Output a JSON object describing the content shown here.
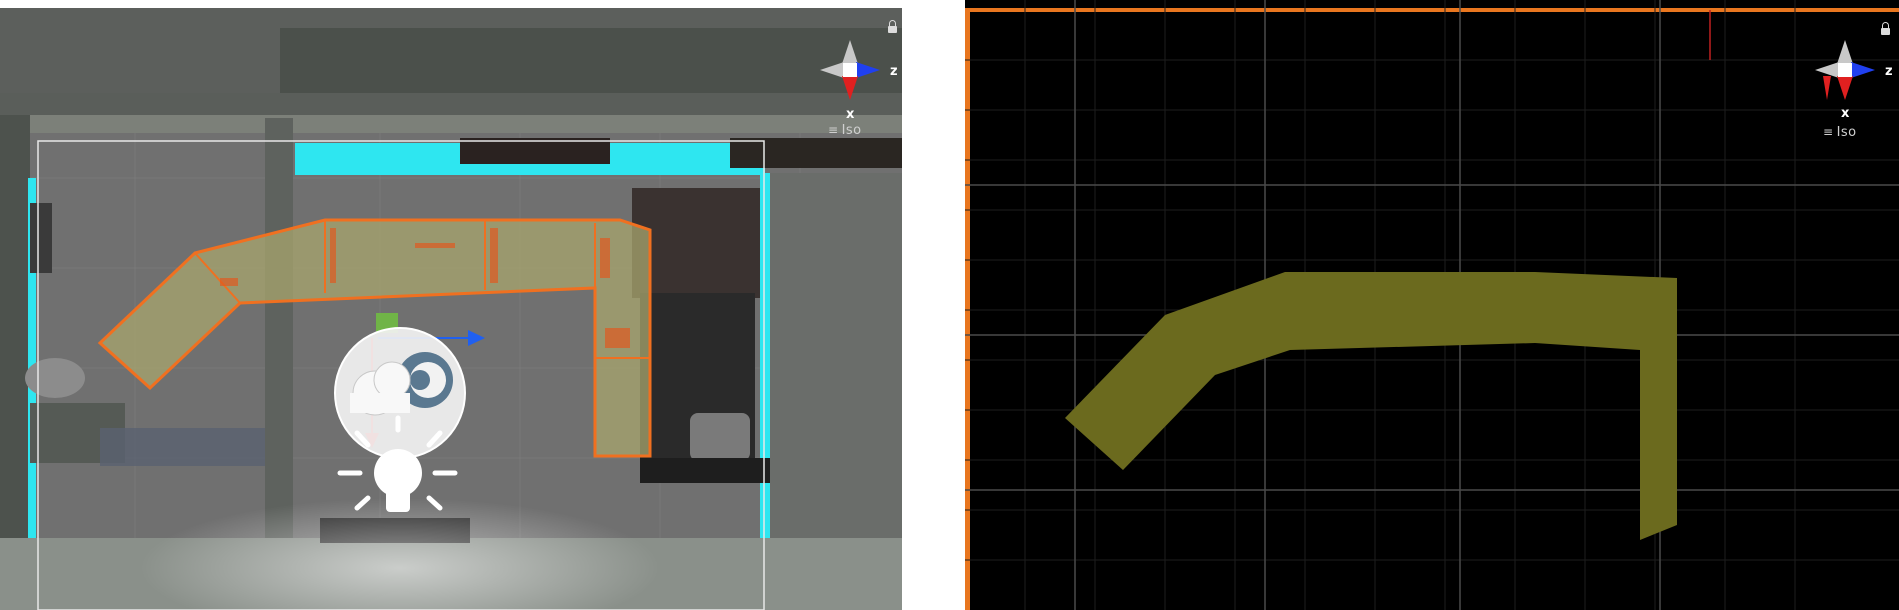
{
  "left_view": {
    "gizmo": {
      "x_label": "x",
      "z_label": "z",
      "projection": "Iso"
    },
    "colors": {
      "selection_outline": "#f07020",
      "cyan_edge": "#2ee6f0",
      "gizmo_x": "#e02020",
      "gizmo_z": "#2040f0"
    },
    "icons": [
      "scene-gizmo-icon",
      "lock-icon",
      "reflection-probe-icon",
      "light-icon",
      "move-tool-handle-icon"
    ]
  },
  "right_view": {
    "gizmo": {
      "x_label": "x",
      "z_label": "z",
      "projection": "Iso"
    },
    "colors": {
      "background": "#000000",
      "navmesh": "#6b6a1e",
      "grid": "#3a3a3a",
      "border": "#e8761f"
    },
    "icons": [
      "scene-gizmo-icon",
      "lock-icon"
    ]
  }
}
